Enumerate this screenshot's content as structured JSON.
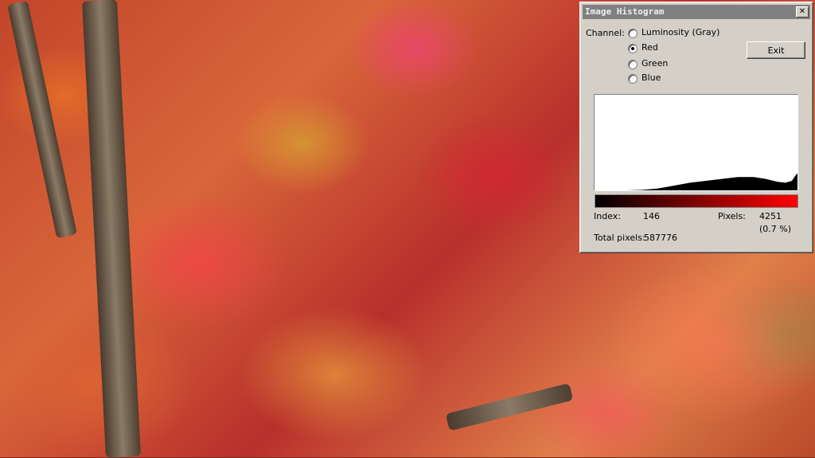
{
  "dialog": {
    "title": "Image Histogram",
    "close_glyph": "✕",
    "channel_label": "Channel:",
    "channels": [
      {
        "label": "Luminosity (Gray)",
        "selected": false
      },
      {
        "label": "Red",
        "selected": true
      },
      {
        "label": "Green",
        "selected": false
      },
      {
        "label": "Blue",
        "selected": false
      }
    ],
    "exit_label": "Exit",
    "index_label": "Index:",
    "index_value": "146",
    "pixels_label": "Pixels:",
    "pixels_value": "4251",
    "pixels_percent": "(0.7 %)",
    "total_label": "Total pixels:",
    "total_value": "587776",
    "gradient_colors": [
      "#000000",
      "#ff0000"
    ]
  },
  "histogram": {
    "channel": "Red",
    "bins": 256,
    "ymax": 1.0,
    "profile": [
      [
        0,
        0
      ],
      [
        40,
        0
      ],
      [
        60,
        0.005
      ],
      [
        80,
        0.02
      ],
      [
        100,
        0.05
      ],
      [
        120,
        0.08
      ],
      [
        140,
        0.1
      ],
      [
        160,
        0.12
      ],
      [
        180,
        0.14
      ],
      [
        200,
        0.14
      ],
      [
        215,
        0.12
      ],
      [
        230,
        0.09
      ],
      [
        240,
        0.08
      ],
      [
        248,
        0.1
      ],
      [
        252,
        0.15
      ],
      [
        255,
        0.18
      ]
    ]
  }
}
